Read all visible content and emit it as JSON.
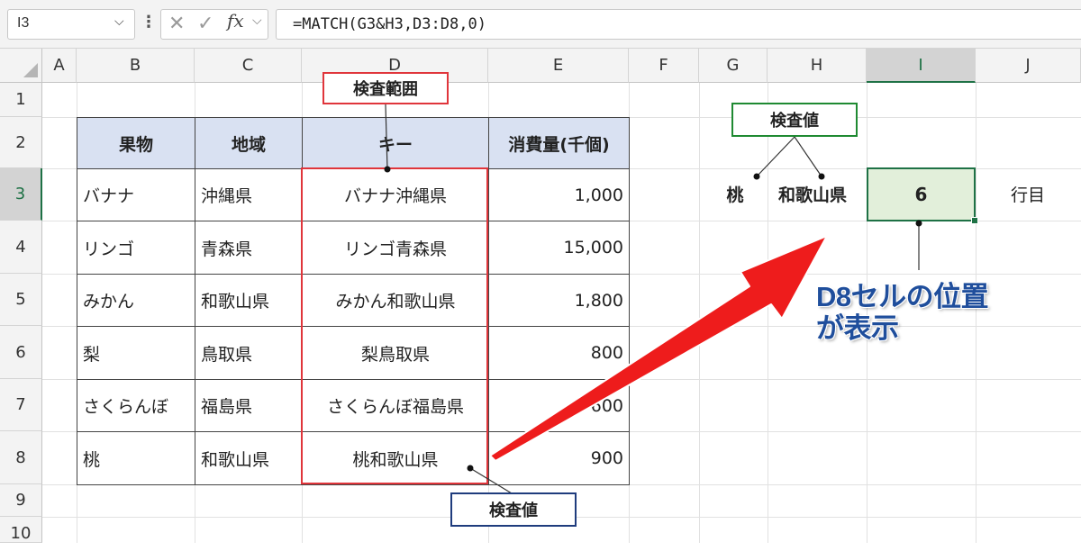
{
  "formula_bar": {
    "name_box": "I3",
    "cancel_icon": "✕",
    "enter_icon": "✓",
    "fx_label": "fx",
    "formula": "=MATCH(G3&H3,D3:D8,0)"
  },
  "columns": [
    "A",
    "B",
    "C",
    "D",
    "E",
    "F",
    "G",
    "H",
    "I",
    "J"
  ],
  "rows": [
    "1",
    "2",
    "3",
    "4",
    "5",
    "6",
    "7",
    "8",
    "9",
    "10"
  ],
  "selected_column": "I",
  "selected_row": "3",
  "table": {
    "headers": [
      "果物",
      "地域",
      "キー",
      "消費量(千個)"
    ],
    "rows": [
      [
        "バナナ",
        "沖縄県",
        "バナナ沖縄県",
        "1,000"
      ],
      [
        "リンゴ",
        "青森県",
        "リンゴ青森県",
        "15,000"
      ],
      [
        "みかん",
        "和歌山県",
        "みかん和歌山県",
        "1,800"
      ],
      [
        "梨",
        "鳥取県",
        "梨鳥取県",
        "800"
      ],
      [
        "さくらんぼ",
        "福島県",
        "さくらんぼ福島県",
        "600"
      ],
      [
        "桃",
        "和歌山県",
        "桃和歌山県",
        "900"
      ]
    ]
  },
  "lookup": {
    "g3": "桃",
    "h3": "和歌山県",
    "result": "6",
    "j3": "行目"
  },
  "callouts": {
    "range": "検査範囲",
    "lookup_top": "検査値",
    "lookup_bottom": "検査値"
  },
  "annotation": {
    "line1": "D8セルの位置",
    "line2": "が表示"
  },
  "colors": {
    "accent_red": "#e0353b",
    "accent_green": "#1f8a32",
    "accent_navy": "#1f3c7d",
    "annotation_blue": "#1f4e9c",
    "header_fill": "#d9e1f2",
    "result_fill": "#e2efda"
  }
}
